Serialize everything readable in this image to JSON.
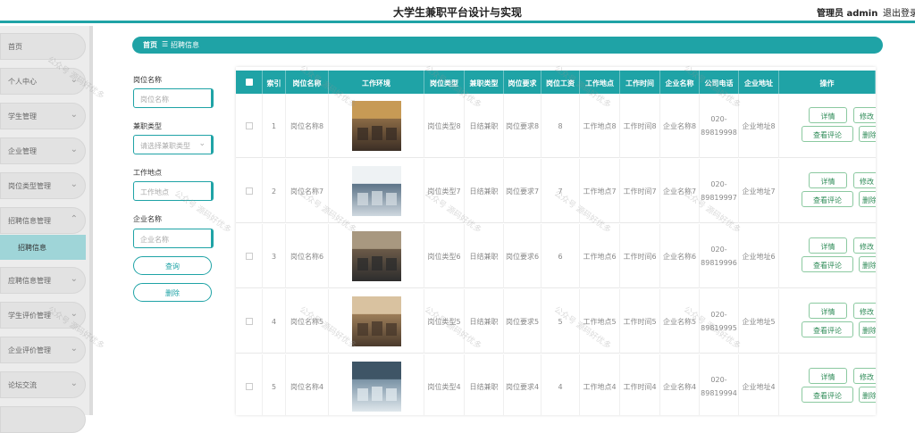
{
  "header": {
    "title": "大学生兼职平台设计与实现",
    "user": "管理员 admin",
    "logout": "退出登录"
  },
  "sidebar": {
    "items": [
      {
        "label": "首页",
        "chevron": false
      },
      {
        "label": "个人中心",
        "chevron": true
      },
      {
        "label": "学生管理",
        "chevron": true
      },
      {
        "label": "企业管理",
        "chevron": true
      },
      {
        "label": "岗位类型管理",
        "chevron": true
      },
      {
        "label": "招聘信息管理",
        "chevron": true
      },
      {
        "label": "应聘信息管理",
        "chevron": true
      },
      {
        "label": "学生评价管理",
        "chevron": true
      },
      {
        "label": "企业评价管理",
        "chevron": true
      },
      {
        "label": "论坛交流",
        "chevron": true
      }
    ],
    "active_sub": "招聘信息"
  },
  "breadcrumb": {
    "home": "首页",
    "sep": "☰",
    "current": "招聘信息"
  },
  "filters": {
    "job_name": {
      "label": "岗位名称",
      "placeholder": "岗位名称"
    },
    "job_type": {
      "label": "兼职类型",
      "placeholder": "请选择兼职类型"
    },
    "location": {
      "label": "工作地点",
      "placeholder": "工作地点"
    },
    "company": {
      "label": "企业名称",
      "placeholder": "企业名称"
    },
    "query_btn": "查询",
    "delete_btn": "删除"
  },
  "table": {
    "columns": [
      "索引",
      "岗位名称",
      "工作环境",
      "岗位类型",
      "兼职类型",
      "岗位要求",
      "岗位工资",
      "工作地点",
      "工作时间",
      "企业名称",
      "公司电话",
      "企业地址",
      "操作"
    ],
    "rows": [
      {
        "idx": "1",
        "name": "岗位名称8",
        "type": "岗位类型8",
        "ptype": "日结兼职",
        "req": "岗位要求8",
        "pay": "8",
        "loc": "工作地点8",
        "time": "工作时间8",
        "company": "企业名称8",
        "phone": "020-89819998",
        "addr": "企业地址8"
      },
      {
        "idx": "2",
        "name": "岗位名称7",
        "type": "岗位类型7",
        "ptype": "日结兼职",
        "req": "岗位要求7",
        "pay": "7",
        "loc": "工作地点7",
        "time": "工作时间7",
        "company": "企业名称7",
        "phone": "020-89819997",
        "addr": "企业地址7"
      },
      {
        "idx": "3",
        "name": "岗位名称6",
        "type": "岗位类型6",
        "ptype": "日结兼职",
        "req": "岗位要求6",
        "pay": "6",
        "loc": "工作地点6",
        "time": "工作时间6",
        "company": "企业名称6",
        "phone": "020-89819996",
        "addr": "企业地址6"
      },
      {
        "idx": "4",
        "name": "岗位名称5",
        "type": "岗位类型5",
        "ptype": "日结兼职",
        "req": "岗位要求5",
        "pay": "5",
        "loc": "工作地点5",
        "time": "工作时间5",
        "company": "企业名称5",
        "phone": "020-89819995",
        "addr": "企业地址5"
      },
      {
        "idx": "5",
        "name": "岗位名称4",
        "type": "岗位类型4",
        "ptype": "日结兼职",
        "req": "岗位要求4",
        "pay": "4",
        "loc": "工作地点4",
        "time": "工作时间4",
        "company": "企业名称4",
        "phone": "020-89819994",
        "addr": "企业地址4"
      }
    ],
    "actions": {
      "detail": "详情",
      "edit": "修改",
      "comments": "查看评论",
      "delete": "删除"
    }
  },
  "watermark": "公众号 源码好优多",
  "colors": {
    "accent": "#1fa3a6",
    "action_text": "#2e8b57"
  }
}
